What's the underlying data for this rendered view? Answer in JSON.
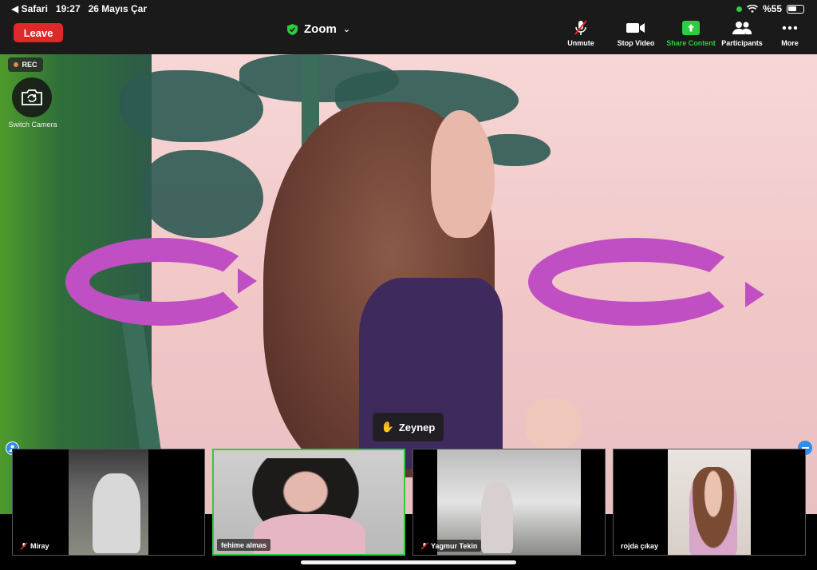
{
  "status": {
    "back_app": "◀ Safari",
    "time": "19:27",
    "date": "26 Mayıs Çar",
    "battery": "%55"
  },
  "toolbar": {
    "leave_label": "Leave",
    "title": "Zoom",
    "unmute_label": "Unmute",
    "stop_video_label": "Stop Video",
    "share_label": "Share Content",
    "participants_label": "Participants",
    "more_label": "More"
  },
  "overlay": {
    "rec_label": "REC",
    "switch_camera_label": "Switch Camera",
    "raised_hand_name": "Zeynep",
    "raised_hand_emoji": "✋"
  },
  "participants": [
    {
      "name": "Miray",
      "muted": true
    },
    {
      "name": "fehime almas",
      "muted": false
    },
    {
      "name": "Yagmur Tekin",
      "muted": true
    },
    {
      "name": "rojda çıkay",
      "muted": false
    }
  ],
  "colors": {
    "leave": "#e02828",
    "active_speaker": "#2ecc40",
    "share": "#2ecc40",
    "accent": "#2d8cf0"
  }
}
